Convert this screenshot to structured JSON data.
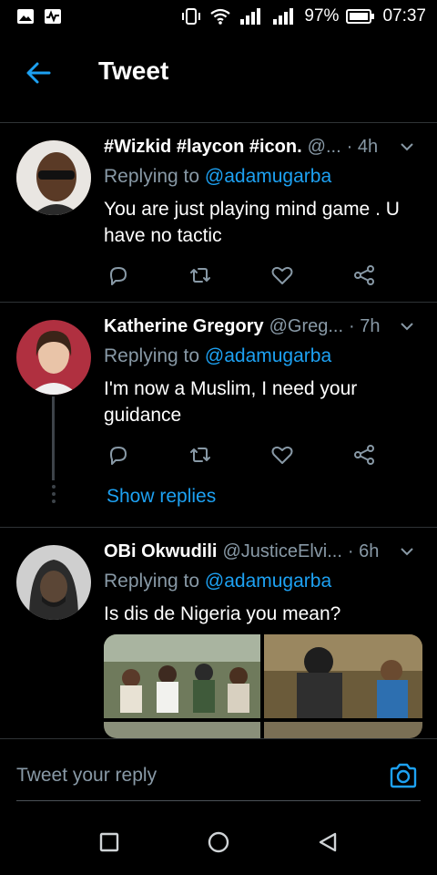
{
  "status_bar": {
    "battery": "97%",
    "time": "07:37"
  },
  "app_bar": {
    "title": "Tweet",
    "back_icon": "arrow-left-icon"
  },
  "tweets": [
    {
      "name": "#Wizkid #laycon #icon.",
      "handle": "@...",
      "time": "· 4h",
      "replying_label": "Replying to",
      "replying_user": "@adamugarba",
      "text_line1": "You are just playing mind game . U",
      "text_line2": "have no tactic"
    },
    {
      "name": "Katherine Gregory",
      "handle": "@Greg...",
      "time": "· 7h",
      "replying_label": "Replying to",
      "replying_user": "@adamugarba",
      "text_line1": "I'm now a Muslim, I need your",
      "text_line2": "guidance",
      "show_replies": "Show replies"
    },
    {
      "name": "OBi Okwudili",
      "handle": "@JusticeElvi...",
      "time": "· 6h",
      "replying_label": "Replying to",
      "replying_user": "@adamugarba",
      "text_line1": "Is dis de Nigeria you mean?"
    }
  ],
  "reply_bar": {
    "placeholder": "Tweet your reply"
  },
  "colors": {
    "accent": "#1da1f2",
    "muted": "#8899a6",
    "divider": "#2f3336",
    "background": "#000000"
  }
}
